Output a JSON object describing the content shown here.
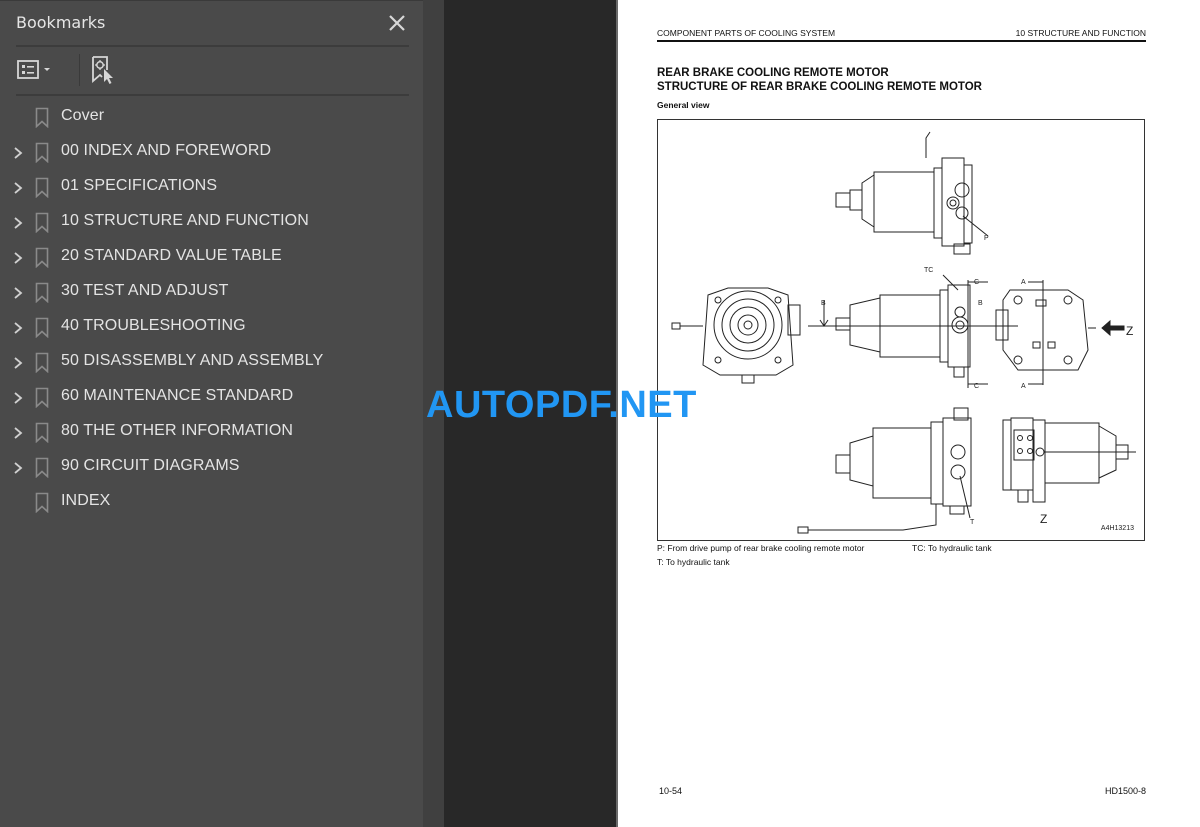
{
  "sidebar": {
    "title": "Bookmarks",
    "close_icon": "close-icon",
    "toolbar": {
      "options_icon": "list-options-icon",
      "find_bookmark_icon": "find-current-bookmark-icon"
    },
    "items": [
      {
        "label": "Cover",
        "expandable": false
      },
      {
        "label": "00 INDEX AND FOREWORD",
        "expandable": true
      },
      {
        "label": "01 SPECIFICATIONS",
        "expandable": true
      },
      {
        "label": "10 STRUCTURE AND FUNCTION",
        "expandable": true
      },
      {
        "label": "20 STANDARD VALUE TABLE",
        "expandable": true
      },
      {
        "label": "30 TEST AND ADJUST",
        "expandable": true
      },
      {
        "label": "40 TROUBLESHOOTING",
        "expandable": true
      },
      {
        "label": "50 DISASSEMBLY AND ASSEMBLY",
        "expandable": true
      },
      {
        "label": "60 MAINTENANCE STANDARD",
        "expandable": true
      },
      {
        "label": "80 THE OTHER INFORMATION",
        "expandable": true
      },
      {
        "label": "90 CIRCUIT DIAGRAMS",
        "expandable": true
      },
      {
        "label": "INDEX",
        "expandable": false
      }
    ]
  },
  "page": {
    "header_left": "COMPONENT PARTS OF COOLING SYSTEM",
    "header_right": "10 STRUCTURE AND FUNCTION",
    "title_line1": "REAR BRAKE COOLING REMOTE MOTOR",
    "title_line2": "STRUCTURE OF REAR BRAKE COOLING REMOTE MOTOR",
    "subtitle": "General view",
    "figure": {
      "id": "A4H13213",
      "labels": {
        "P": "P",
        "TC": "TC",
        "T": "T",
        "A": "A",
        "B": "B",
        "C": "C",
        "Z": "Z"
      }
    },
    "legend": [
      "P: From drive pump of rear brake cooling remote motor",
      "TC: To hydraulic tank",
      "T: To hydraulic tank"
    ],
    "footer_left": "10-54",
    "footer_right": "HD1500-8"
  },
  "watermark": "AUTOPDF.NET",
  "colors": {
    "sidebar_bg": "#4a4a4a",
    "canvas_bg": "#282828",
    "watermark": "#2196f3"
  }
}
